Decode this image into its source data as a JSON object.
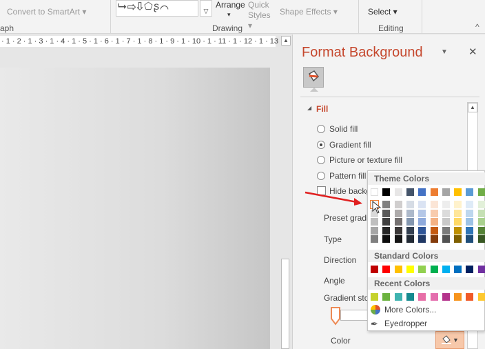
{
  "ribbon": {
    "convert_smartart": "Convert to SmartArt ▾",
    "shapes_glyphs": "⮡⇨⇩⬠ʂ⌒",
    "arrange": "Arrange",
    "arrange_caret": "▾",
    "quick_styles": "Quick Styles ▾",
    "shape_effects": "Shape Effects ▾",
    "select": "Select ▾",
    "groups": {
      "paragraph": "aph",
      "drawing": "Drawing",
      "editing": "Editing"
    },
    "collapse": "^"
  },
  "ruler": {
    "text": "· 1 · 2 · 1 · 3 · 1 · 4 · 1 · 5 · 1 · 6 · 1 · 7 · 1 · 8 · 1 · 9 · 1 · 10 · 1 · 11 · 1 · 12 · 1 · 13 · 1 · 14 · 1 · 15 · 1 · 16 · 1 ·"
  },
  "pane": {
    "title": "Format Background",
    "menu_caret": "▼",
    "close": "✕",
    "fill_header": "Fill",
    "fill_options": [
      {
        "label": "Solid fill",
        "selected": false
      },
      {
        "label": "Gradient fill",
        "selected": true
      },
      {
        "label": "Picture or texture fill",
        "selected": false
      },
      {
        "label": "Pattern fill",
        "selected": false
      }
    ],
    "hide_background": "Hide background graphics",
    "preset": "Preset gradients",
    "type": "Type",
    "direction": "Direction",
    "angle": "Angle",
    "gradient_stops": "Gradient stops",
    "color": "Color"
  },
  "popup": {
    "theme_header": "Theme Colors",
    "standard_header": "Standard Colors",
    "recent_header": "Recent Colors",
    "more_colors": "More Colors...",
    "eyedropper": "Eyedropper",
    "theme_top": [
      "#ffffff",
      "#000000",
      "#e7e6e6",
      "#44546a",
      "#4472c4",
      "#ed7d31",
      "#a5a5a5",
      "#ffc000",
      "#5b9bd5",
      "#70ad47"
    ],
    "theme_shades": [
      [
        "#f2f2f2",
        "#d9d9d9",
        "#bfbfbf",
        "#a6a6a6",
        "#808080"
      ],
      [
        "#808080",
        "#595959",
        "#404040",
        "#262626",
        "#0d0d0d"
      ],
      [
        "#d0cece",
        "#aeabab",
        "#757171",
        "#3b3838",
        "#161616"
      ],
      [
        "#d6dce5",
        "#adb9ca",
        "#8497b0",
        "#333f50",
        "#222a35"
      ],
      [
        "#dae3f3",
        "#b4c7e7",
        "#8faadc",
        "#2f5597",
        "#203864"
      ],
      [
        "#fbe5d6",
        "#f8cbad",
        "#f4b183",
        "#c55a11",
        "#843c0c"
      ],
      [
        "#ededed",
        "#dbdbdb",
        "#c9c9c9",
        "#7b7b7b",
        "#525252"
      ],
      [
        "#fff2cc",
        "#ffe699",
        "#ffd966",
        "#bf9000",
        "#7f6000"
      ],
      [
        "#deebf7",
        "#bdd7ee",
        "#9dc3e6",
        "#2e75b6",
        "#1f4e79"
      ],
      [
        "#e2f0d9",
        "#c5e0b4",
        "#a9d18e",
        "#548235",
        "#385723"
      ]
    ],
    "standard": [
      "#c00000",
      "#ff0000",
      "#ffc000",
      "#ffff00",
      "#92d050",
      "#00b050",
      "#00b0f0",
      "#0070c0",
      "#002060",
      "#7030a0"
    ],
    "recent": [
      "#c5d22c",
      "#6cb33f",
      "#3fb3b0",
      "#168a8f",
      "#e76fa7",
      "#e46fae",
      "#b4338b",
      "#f7941d",
      "#f05a28",
      "#fdc82f"
    ],
    "highlight_color": "#ed7d31"
  },
  "annotation_arrow_color": "#e02020"
}
